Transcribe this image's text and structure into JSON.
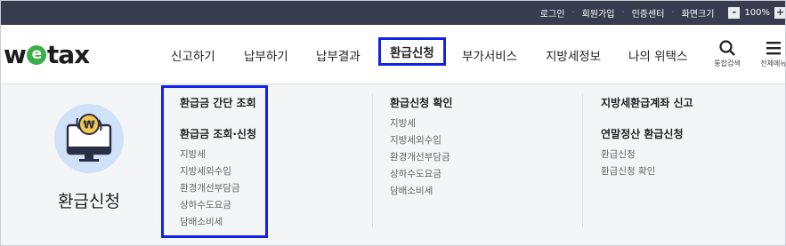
{
  "topbar": {
    "login": "로그인",
    "join": "회원가입",
    "auth": "인증센터",
    "zoom_label": "화면크기",
    "zoom_minus": "-",
    "zoom_value": "100%",
    "zoom_plus": "+"
  },
  "logo": {
    "pre": "w",
    "e": "e",
    "post": "tax"
  },
  "nav": {
    "items": [
      "신고하기",
      "납부하기",
      "납부결과",
      "환급신청",
      "부가서비스",
      "지방세정보",
      "나의 위택스"
    ],
    "search_label": "통합검색",
    "menu_label": "전체메뉴"
  },
  "mega": {
    "title": "환급신청",
    "col1": {
      "h1": "환급금 간단 조회",
      "h2": "환급금 조회·신청",
      "items": [
        "지방세",
        "지방세외수입",
        "환경개선부담금",
        "상하수도요금",
        "담배소비세"
      ]
    },
    "col2": {
      "h1": "환급신청 확인",
      "items": [
        "지방세",
        "지방세외수입",
        "환경개선부담금",
        "상하수도요금",
        "담배소비세"
      ]
    },
    "col3": {
      "h1": "지방세환급계좌 신고",
      "h2": "연말정산 환급신청",
      "items": [
        "환급신청",
        "환급신청 확인"
      ]
    }
  },
  "colors": {
    "topbar": "#393c4f",
    "highlight": "#0f22e6",
    "logo_green": "#3aae49"
  }
}
